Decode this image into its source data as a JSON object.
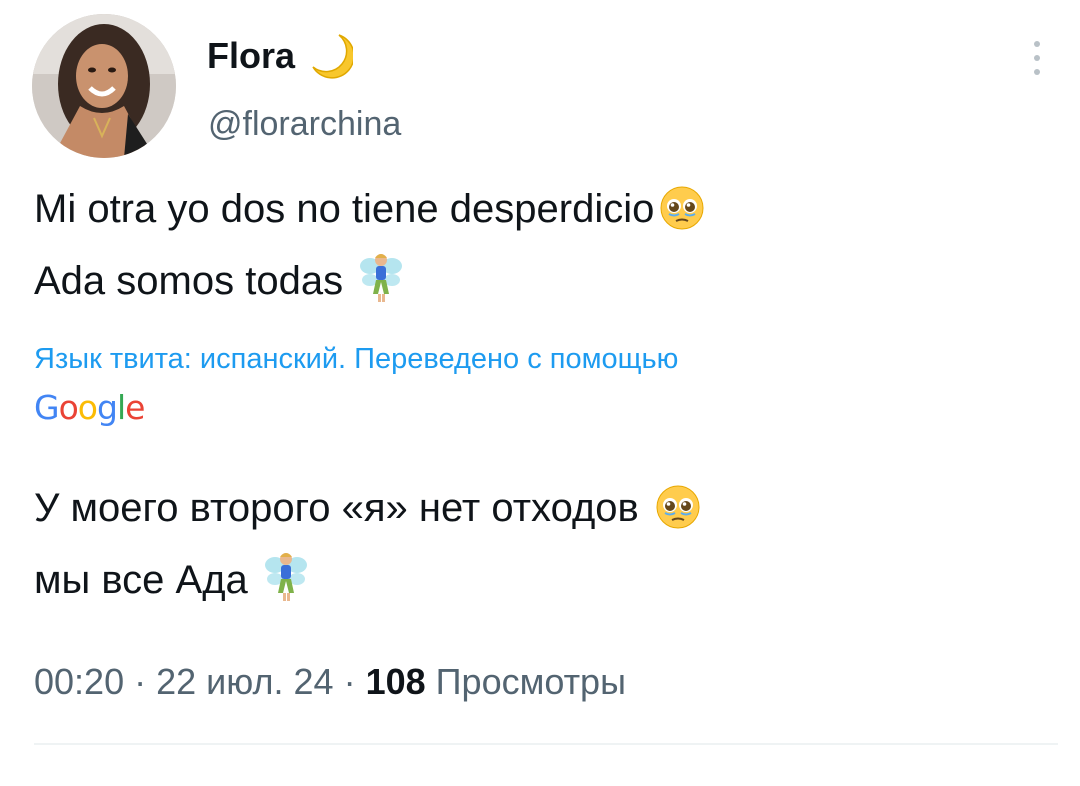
{
  "author": {
    "display_name": "Flora",
    "display_name_emoji": "crescent-moon-icon",
    "handle": "@florarchina",
    "avatar": "user-avatar-photo"
  },
  "tweet": {
    "lines": [
      "Mi otra yo dos no tiene desperdicio",
      "Ada somos todas"
    ],
    "line_emojis": [
      "pleading-face-icon",
      "fairy-icon"
    ]
  },
  "translation": {
    "info": "Язык твита: испанский. Переведено с помощью",
    "provider": "Google",
    "lines": [
      "У моего второго «я» нет отходов",
      "мы все Ада"
    ],
    "line_emojis": [
      "pleading-face-icon",
      "fairy-icon"
    ]
  },
  "meta": {
    "time": "00:20",
    "separator": "·",
    "date": "22 июл. 24",
    "views_count": "108",
    "views_label": "Просмотры"
  },
  "colors": {
    "link_blue": "#1d9bf0",
    "secondary_text": "#536471",
    "primary_text": "#0f1419",
    "divider": "#eff3f4"
  }
}
